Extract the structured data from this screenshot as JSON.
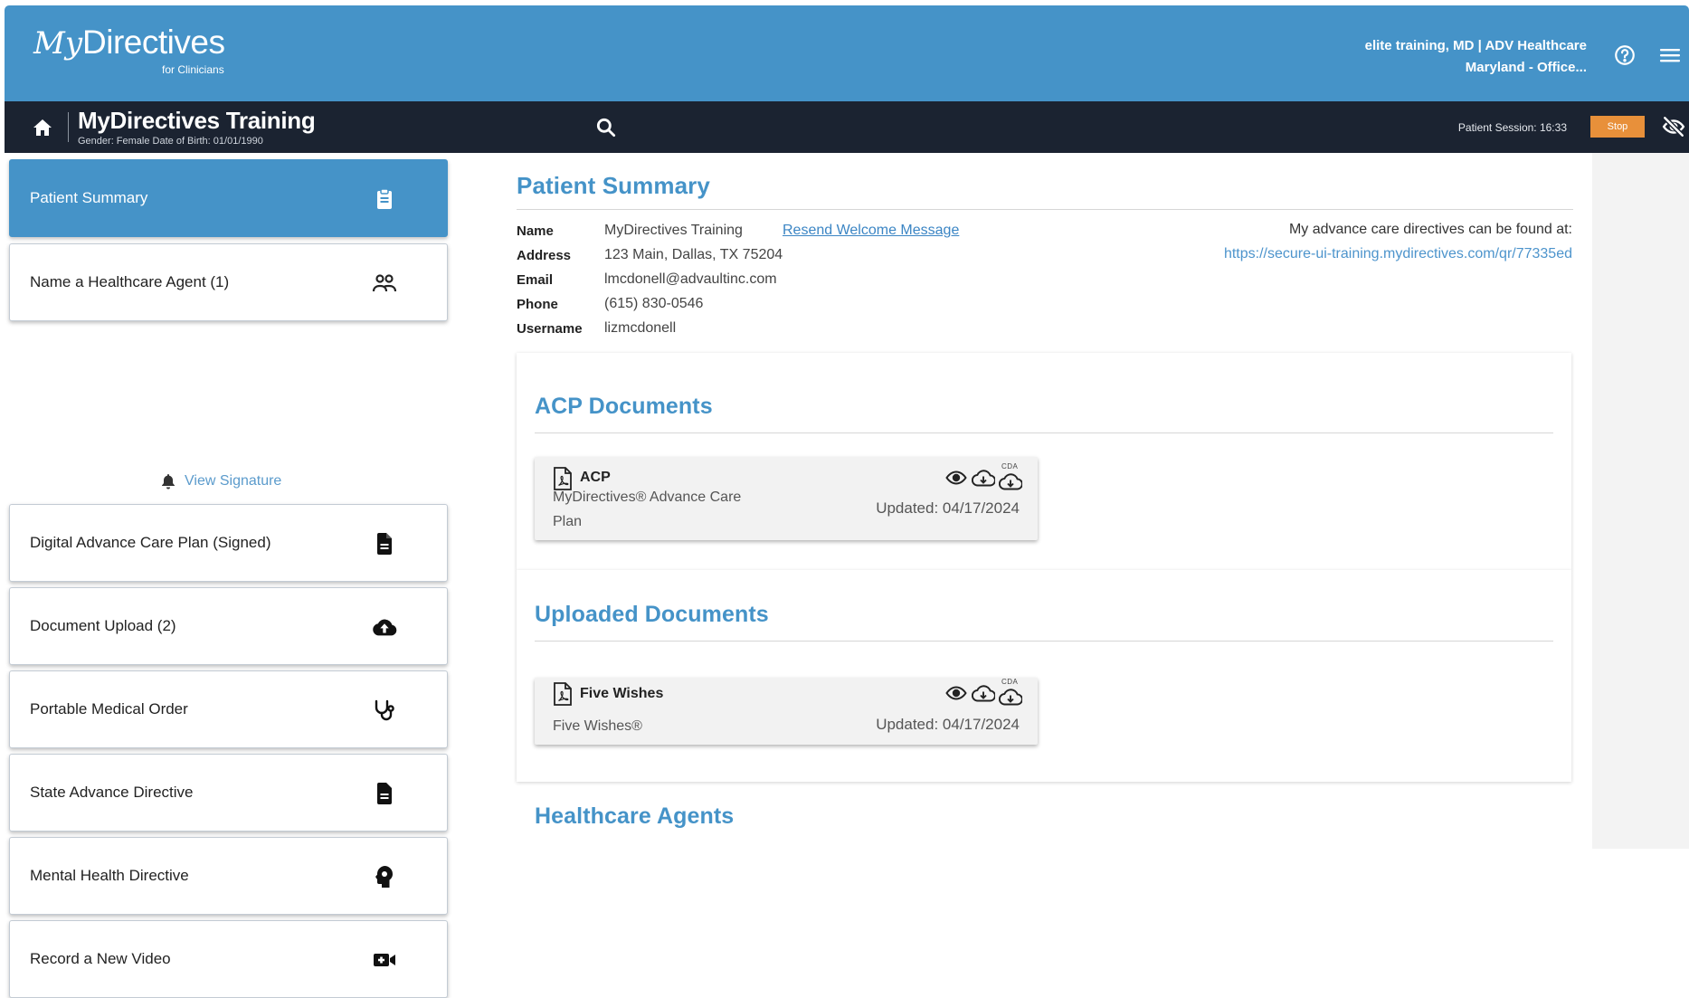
{
  "brand": {
    "script": "My",
    "word": "Directives",
    "sub": "for Clinicians"
  },
  "user": {
    "line1": "elite training, MD | ADV Healthcare",
    "line2": "Maryland - Office..."
  },
  "patient_bar": {
    "name": "MyDirectives Training",
    "meta": "Gender: Female   Date of Birth: 01/01/1990",
    "session_label": "Patient Session: 16:33",
    "stop_label": "Stop"
  },
  "sidebar": {
    "items": [
      {
        "label": "Patient Summary",
        "icon": "clipboard-icon"
      },
      {
        "label": "Name a Healthcare Agent (1)",
        "icon": "people-icon"
      },
      {
        "label": "Digital Advance Care Plan (Signed)",
        "icon": "document-icon"
      },
      {
        "label": "Document Upload (2)",
        "icon": "cloud-upload-icon"
      },
      {
        "label": "Portable Medical Order",
        "icon": "stethoscope-icon"
      },
      {
        "label": "State Advance Directive",
        "icon": "document-icon"
      },
      {
        "label": "Mental Health Directive",
        "icon": "head-icon"
      },
      {
        "label": "Record a New Video",
        "icon": "video-plus-icon"
      }
    ],
    "view_signature": "View Signature"
  },
  "summary": {
    "title": "Patient Summary",
    "fields": [
      {
        "label": "Name",
        "value": "MyDirectives Training"
      },
      {
        "label": "Address",
        "value": "123 Main, Dallas, TX 75204"
      },
      {
        "label": "Email",
        "value": "lmcdonell@advaultinc.com"
      },
      {
        "label": "Phone",
        "value": "(615) 830-0546"
      },
      {
        "label": "Username",
        "value": "lizmcdonell"
      }
    ],
    "resend_link": "Resend Welcome Message",
    "directives_note": "My advance care directives can be found at:",
    "directives_url": "https://secure-ui-training.mydirectives.com/qr/77335ed"
  },
  "acp": {
    "title": "ACP Documents",
    "doc": {
      "name": "ACP",
      "desc1": "MyDirectives® Advance Care",
      "desc2": "Plan",
      "updated": "Updated: 04/17/2024",
      "cda": "CDA"
    }
  },
  "uploaded": {
    "title": "Uploaded Documents",
    "doc": {
      "name": "Five Wishes",
      "desc1": "Five Wishes®",
      "updated": "Updated: 04/17/2024",
      "cda": "CDA"
    }
  },
  "agents": {
    "title": "Healthcare Agents"
  },
  "colors": {
    "brand_blue": "#4593c8",
    "navbar_dark": "#1b2331",
    "stop_orange": "#e8903a",
    "link_blue": "#3b85c4"
  }
}
